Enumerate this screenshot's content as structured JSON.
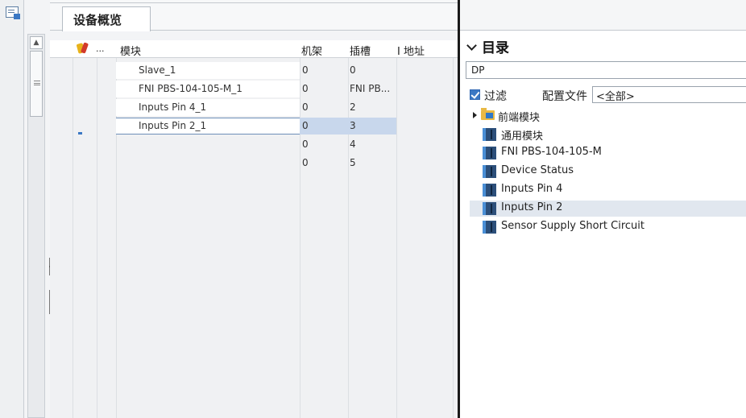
{
  "device_overview": {
    "tab_title": "设备概览",
    "columns": {
      "module": "模块",
      "rack": "机架",
      "slot": "插槽",
      "address": "I 地址",
      "ellipsis": "..."
    },
    "rows": [
      {
        "module": "Slave_1",
        "rack": "0",
        "slot": "0"
      },
      {
        "module": "FNI PBS-104-105-M_1",
        "rack": "0",
        "slot": "FNI PB..."
      },
      {
        "module": "Inputs Pin 4_1",
        "rack": "0",
        "slot": "2"
      },
      {
        "module": "Inputs Pin 2_1",
        "rack": "0",
        "slot": "3",
        "selected": true
      },
      {
        "module": "",
        "rack": "0",
        "slot": "4"
      },
      {
        "module": "",
        "rack": "0",
        "slot": "5"
      }
    ]
  },
  "catalog": {
    "title": "目录",
    "search_value": "DP",
    "filter_label": "过滤",
    "filter_checked": true,
    "profile_label": "配置文件",
    "profile_value": "<全部>",
    "tree": [
      {
        "label": "前端模块",
        "icon": "folder-icon",
        "expandable": true
      },
      {
        "label": "通用模块",
        "icon": "module-icon"
      },
      {
        "label": "FNI PBS-104-105-M",
        "icon": "module-icon"
      },
      {
        "label": "Device Status",
        "icon": "module-icon"
      },
      {
        "label": "Inputs Pin 4",
        "icon": "module-icon"
      },
      {
        "label": "Inputs Pin 2",
        "icon": "module-icon",
        "highlighted": true
      },
      {
        "label": "Sensor Supply Short Circuit",
        "icon": "module-icon"
      }
    ]
  },
  "colors": {
    "selection": "#c8d7ec",
    "checkbox": "#3b78c4",
    "splitter": "#1a1a1a"
  }
}
